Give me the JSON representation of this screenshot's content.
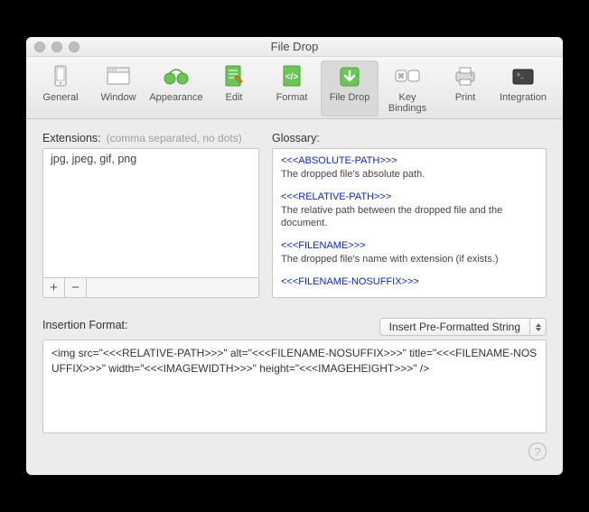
{
  "window": {
    "title": "File Drop"
  },
  "toolbar": {
    "items": [
      {
        "label": "General"
      },
      {
        "label": "Window"
      },
      {
        "label": "Appearance"
      },
      {
        "label": "Edit"
      },
      {
        "label": "Format"
      },
      {
        "label": "File Drop"
      },
      {
        "label": "Key Bindings"
      },
      {
        "label": "Print"
      },
      {
        "label": "Integration"
      }
    ],
    "selected_index": 5
  },
  "extensions": {
    "label": "Extensions:",
    "hint": "(comma separated, no dots)",
    "rows": [
      "jpg, jpeg, gif, png"
    ],
    "add_label": "+",
    "remove_label": "−"
  },
  "glossary": {
    "label": "Glossary:",
    "items": [
      {
        "key": "<<<ABSOLUTE-PATH>>>",
        "desc": "The dropped file's absolute path."
      },
      {
        "key": "<<<RELATIVE-PATH>>>",
        "desc": "The relative path between the dropped file and the document."
      },
      {
        "key": "<<<FILENAME>>>",
        "desc": "The dropped file's name with extension (if exists.)"
      },
      {
        "key": "<<<FILENAME-NOSUFFIX>>>",
        "desc": ""
      }
    ]
  },
  "insertion": {
    "label": "Insertion Format:",
    "dropdown": "Insert Pre-Formatted String",
    "text": "<img src=\"<<<RELATIVE-PATH>>>\" alt=\"<<<FILENAME-NOSUFFIX>>>\" title=\"<<<FILENAME-NOSUFFIX>>>\" width=\"<<<IMAGEWIDTH>>>\" height=\"<<<IMAGEHEIGHT>>>\" />"
  },
  "help_tooltip": "?"
}
